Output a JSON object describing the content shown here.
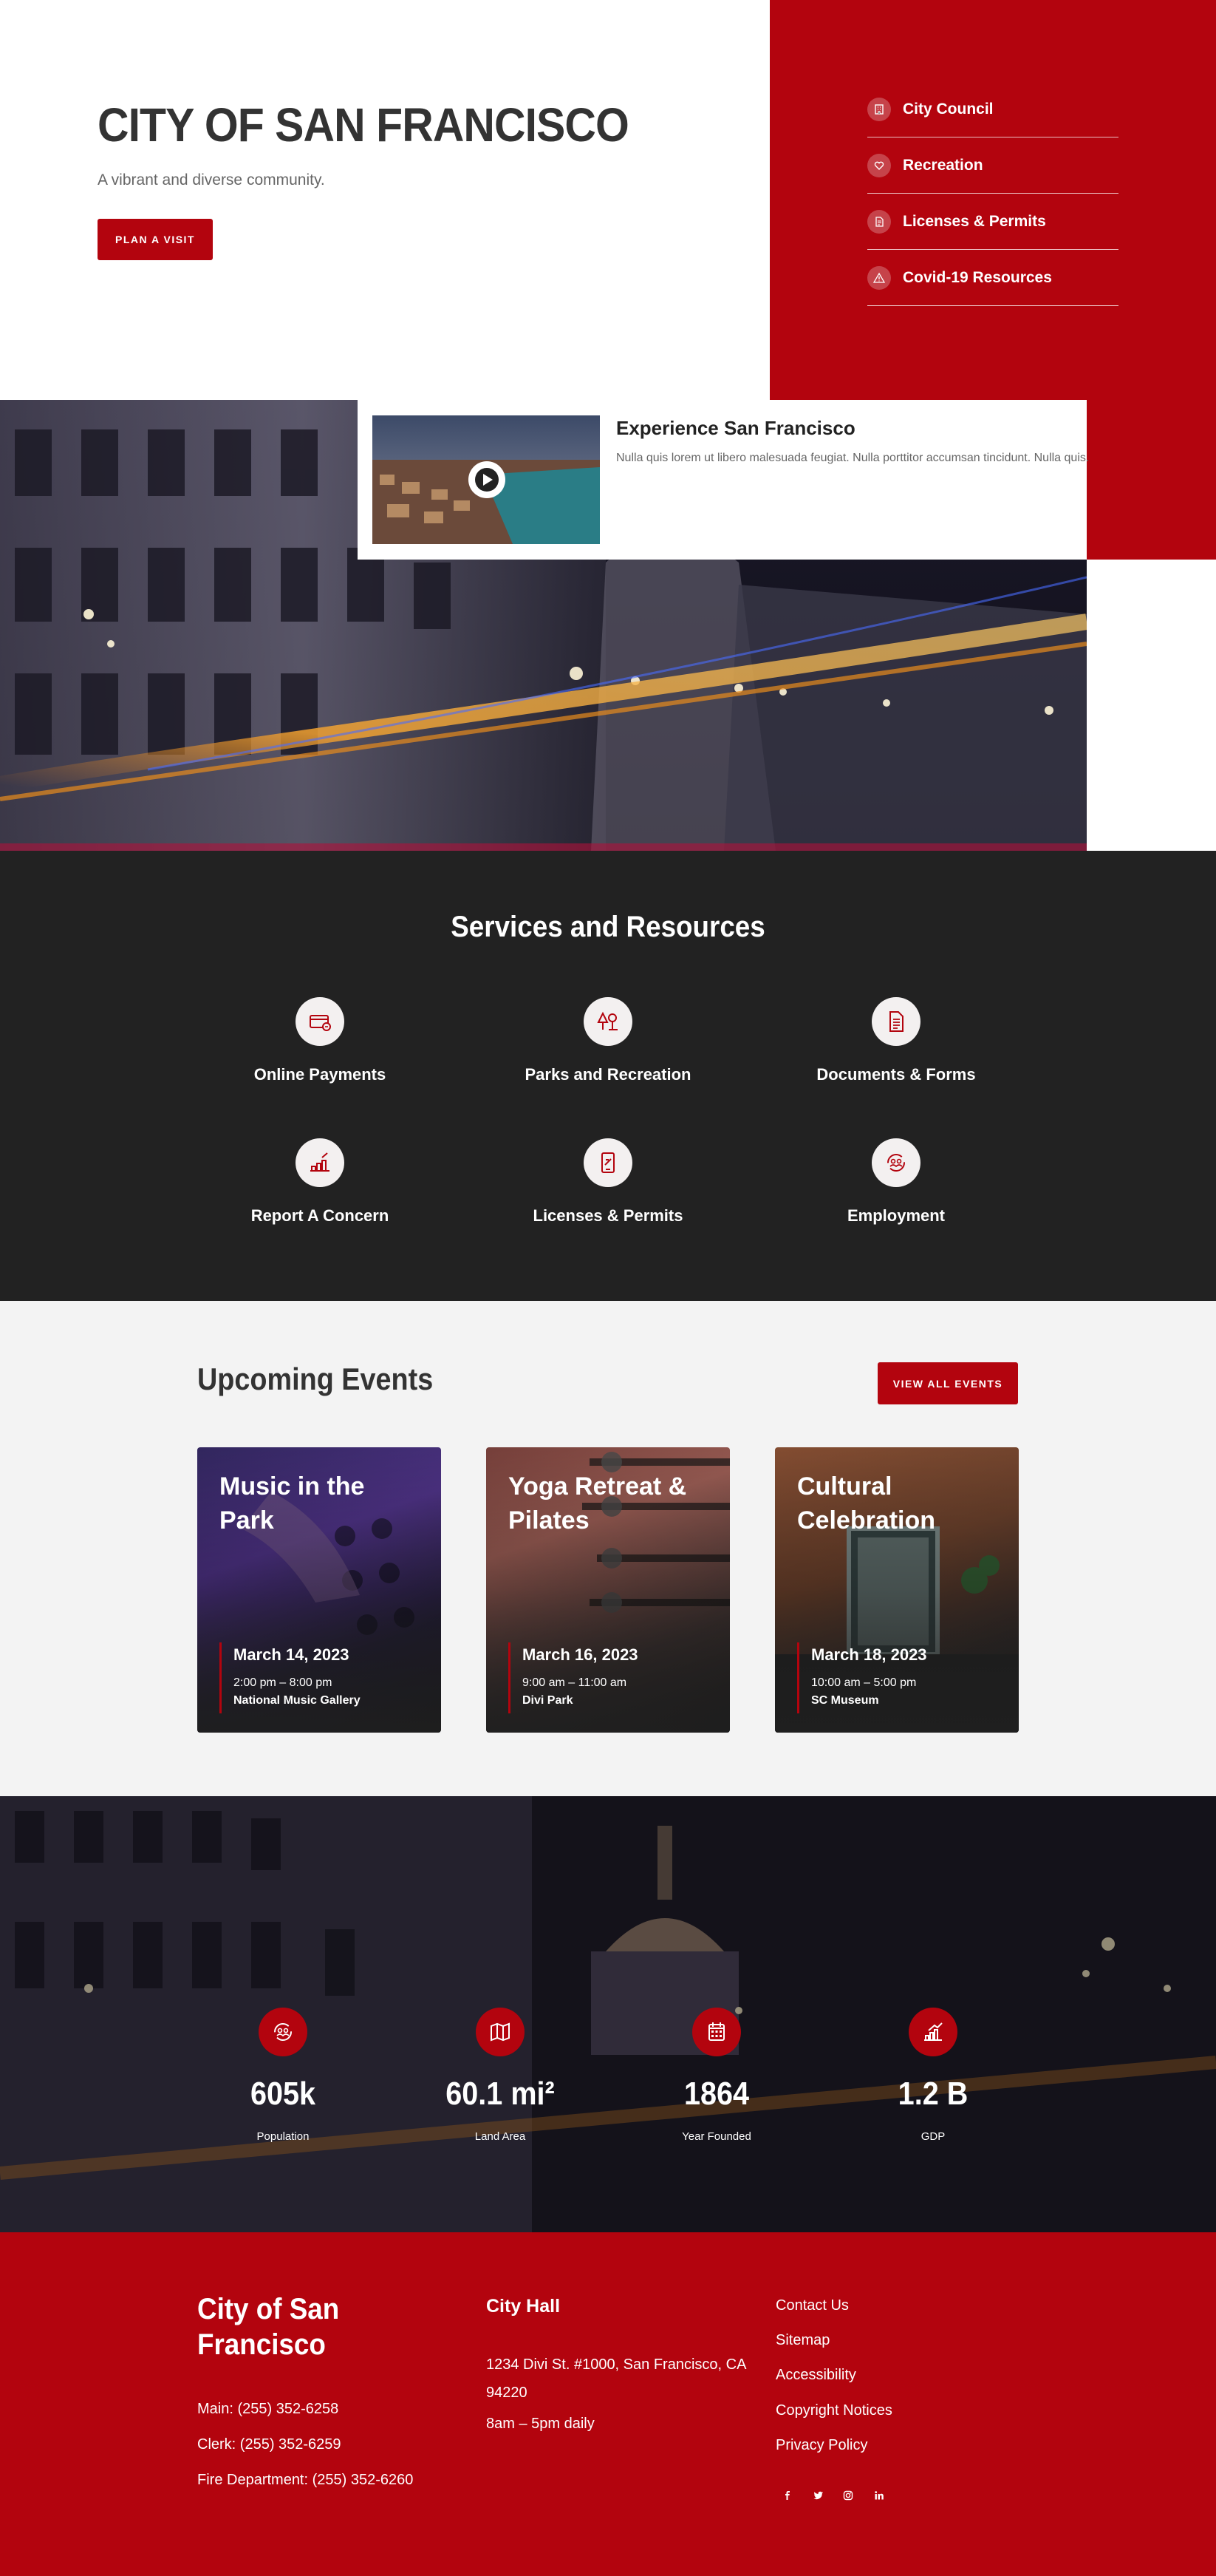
{
  "hero": {
    "title": "CITY OF SAN FRANCISCO",
    "subtitle": "A vibrant and diverse community.",
    "button": "PLAN A VISIT",
    "side_links": [
      {
        "label": "City Council",
        "icon": "building-icon"
      },
      {
        "label": "Recreation",
        "icon": "heart-icon"
      },
      {
        "label": "Licenses & Permits",
        "icon": "document-icon"
      },
      {
        "label": "Covid-19 Resources",
        "icon": "warning-icon"
      }
    ]
  },
  "video": {
    "title": "Experience San Francisco",
    "description": "Nulla quis lorem ut libero malesuada feugiat. Nulla porttitor accumsan tincidunt. Nulla quis."
  },
  "services": {
    "title": "Services and Resources",
    "items": [
      {
        "label": "Online Payments",
        "icon": "credit-card-icon"
      },
      {
        "label": "Parks and Recreation",
        "icon": "tree-icon"
      },
      {
        "label": "Documents & Forms",
        "icon": "document-icon"
      },
      {
        "label": "Report A Concern",
        "icon": "chart-hand-icon"
      },
      {
        "label": "Licenses & Permits",
        "icon": "permit-icon"
      },
      {
        "label": "Employment",
        "icon": "people-cycle-icon"
      }
    ]
  },
  "events": {
    "title": "Upcoming Events",
    "button": "VIEW ALL EVENTS",
    "items": [
      {
        "title": "Music in the Park",
        "date": "March 14, 2023",
        "time": "2:00 pm – 8:00 pm",
        "place": "National Music Gallery"
      },
      {
        "title": "Yoga Retreat & Pilates",
        "date": "March 16, 2023",
        "time": "9:00 am – 11:00 am",
        "place": "Divi Park"
      },
      {
        "title": "Cultural Celebration",
        "date": "March 18, 2023",
        "time": "10:00 am – 5:00 pm",
        "place": "SC Museum"
      }
    ]
  },
  "stats": [
    {
      "value": "605k",
      "label": "Population",
      "icon": "people-cycle-icon"
    },
    {
      "value": "60.1 mi²",
      "label": "Land Area",
      "icon": "map-icon"
    },
    {
      "value": "1864",
      "label": "Year Founded",
      "icon": "calendar-icon"
    },
    {
      "value": "1.2 B",
      "label": "GDP",
      "icon": "chart-hand-icon"
    }
  ],
  "footer": {
    "city": "City of San Francisco",
    "main_phone": "Main: (255) 352-6258",
    "clerk_phone": "Clerk: (255) 352-6259",
    "fire_phone": "Fire Department: (255) 352-6260",
    "hall_title": "City Hall",
    "address": "1234 Divi St. #1000, San Francisco, CA 94220",
    "hours": "8am – 5pm daily",
    "links": [
      "Contact Us",
      "Sitemap",
      "Accessibility",
      "Copyright Notices",
      "Privacy Policy"
    ],
    "social": [
      "f",
      "t",
      "ig",
      "in"
    ]
  },
  "colors": {
    "brand_red": "#b3040e",
    "dark": "#222222",
    "light_bg": "#f3f3f3"
  }
}
